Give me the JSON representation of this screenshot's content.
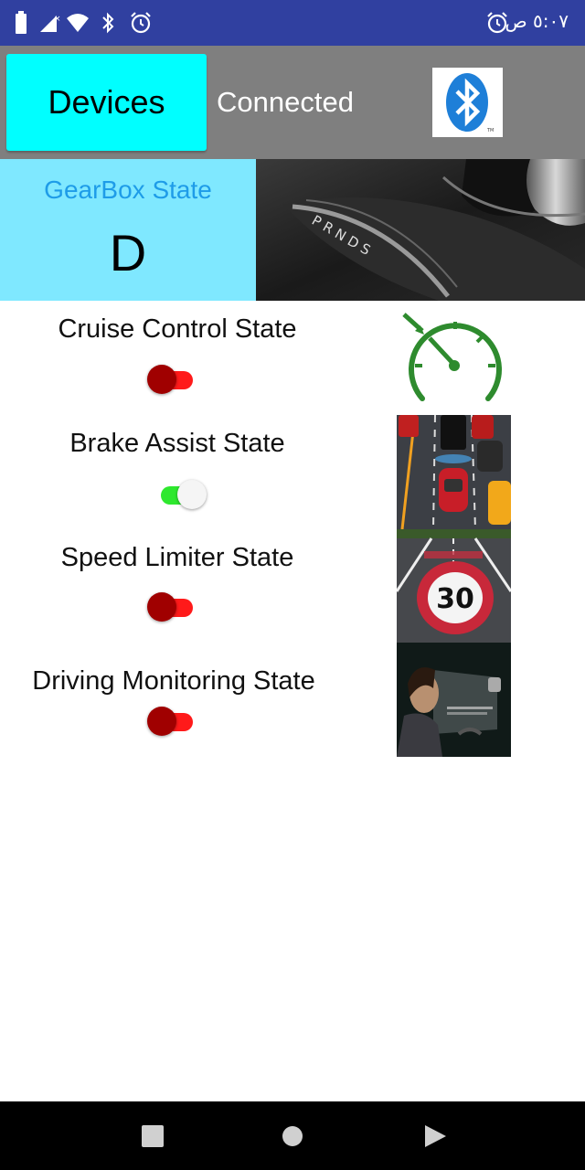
{
  "status_bar": {
    "time": "٥:٠٧ ص",
    "icons": [
      "battery-icon",
      "no-signal-icon",
      "wifi-icon",
      "bluetooth-icon",
      "alarm-icon",
      "alarm-right-icon"
    ]
  },
  "header": {
    "devices_label": "Devices",
    "connection_status": "Connected",
    "bluetooth_logo": "bluetooth-logo"
  },
  "gearbox": {
    "title": "GearBox State",
    "value": "D",
    "image": "gear-shifter-photo"
  },
  "features": [
    {
      "label": "Cruise Control State",
      "on": false,
      "image": "speedometer-icon"
    },
    {
      "label": "Brake Assist State",
      "on": true,
      "image": "brake-assist-photo"
    },
    {
      "label": "Speed Limiter State",
      "on": false,
      "image": "speed-limit-30-photo",
      "sign_text": "30"
    },
    {
      "label": "Driving Monitoring State",
      "on": false,
      "image": "driver-monitoring-photo"
    }
  ],
  "nav_bar": {
    "buttons": [
      "recents-button",
      "home-button",
      "back-button"
    ]
  },
  "colors": {
    "status_bar": "#3040a0",
    "header": "#7f7f7f",
    "devices_button": "#00ffff",
    "gear_panel": "#7fe8ff",
    "gear_title": "#1e9ce8",
    "toggle_off_track": "#ff1a1a",
    "toggle_off_thumb": "#a00000",
    "toggle_on_track": "#2ee82e",
    "speedometer": "#2e8b2e"
  }
}
